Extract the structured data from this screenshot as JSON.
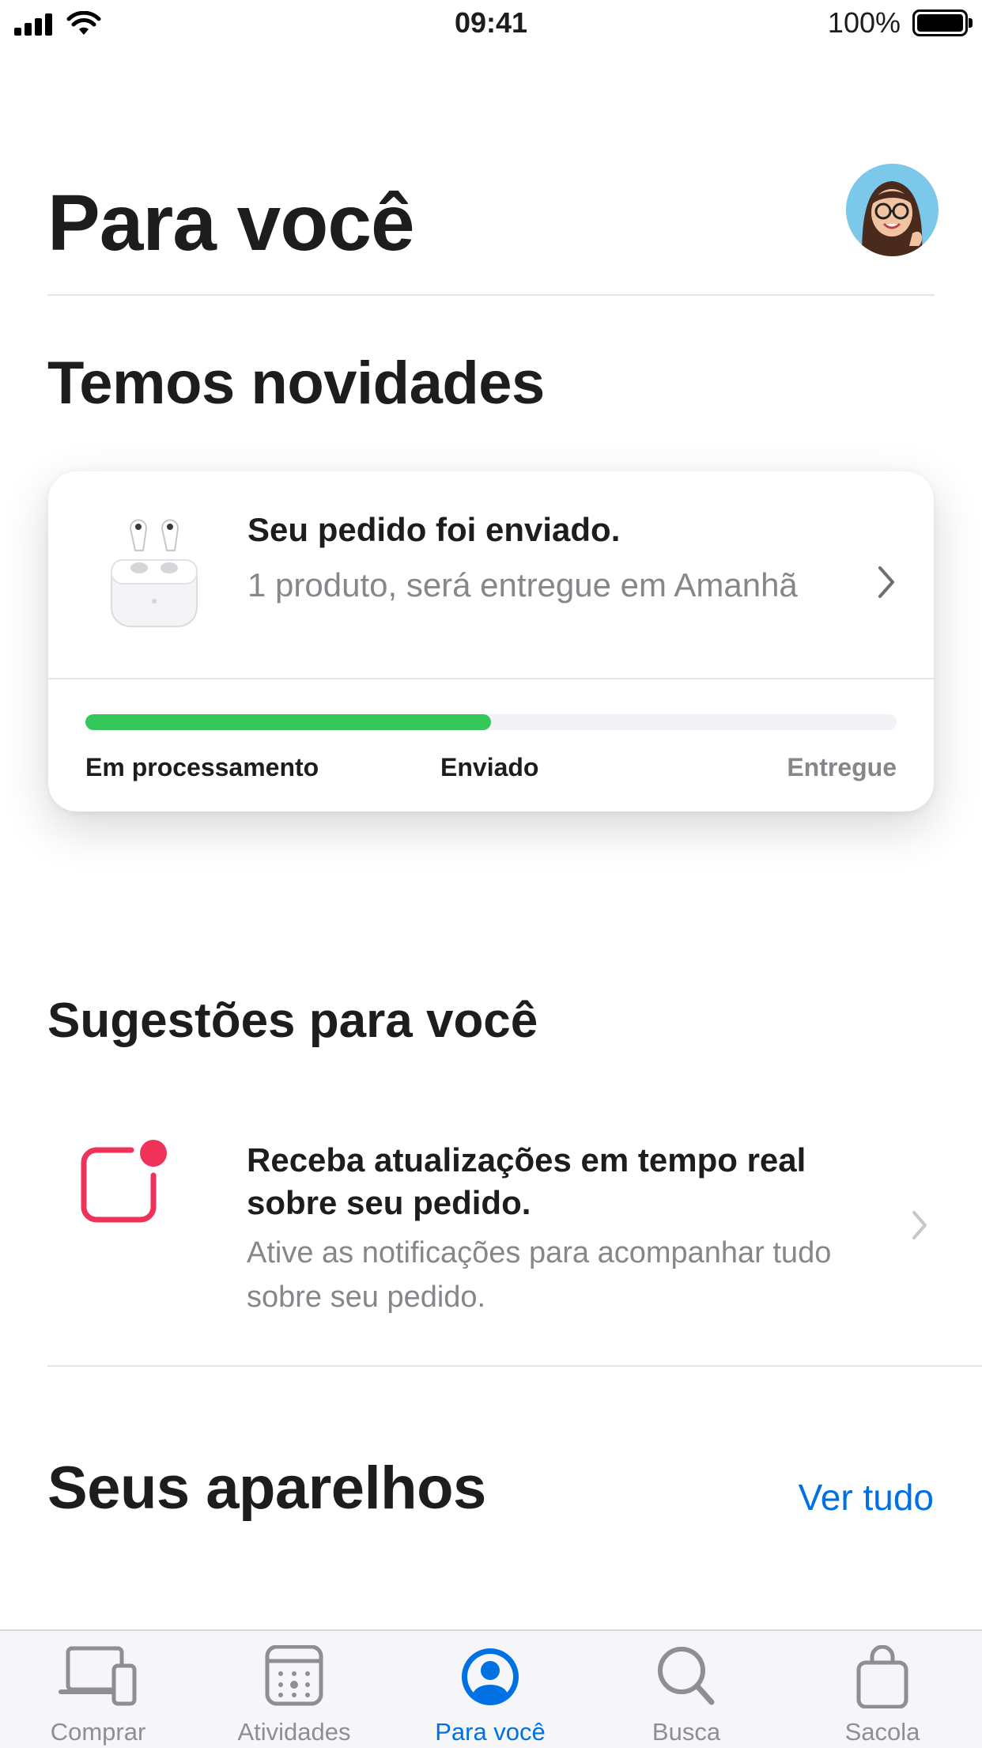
{
  "status_bar": {
    "time": "09:41",
    "battery": "100%"
  },
  "header": {
    "title": "Para você"
  },
  "news": {
    "title": "Temos novidades",
    "order": {
      "title": "Seu pedido foi enviado.",
      "subtitle": "1 produto, será entregue em Amanhã",
      "progress": 0.5,
      "stages": [
        "Em processamento",
        "Enviado",
        "Entregue"
      ]
    }
  },
  "suggestions": {
    "title": "Sugestões para você",
    "item": {
      "title": "Receba atualizações em tempo real sobre seu pedido.",
      "text": "Ative as notificações para acompanhar tudo sobre seu pedido."
    }
  },
  "devices": {
    "title": "Seus aparelhos",
    "link": "Ver tudo"
  },
  "tabbar": {
    "tabs": [
      {
        "label": "Comprar",
        "icon": "devices-icon"
      },
      {
        "label": "Atividades",
        "icon": "calendar-icon"
      },
      {
        "label": "Para você",
        "icon": "person-circle-icon",
        "active": true
      },
      {
        "label": "Busca",
        "icon": "search-icon"
      },
      {
        "label": "Sacola",
        "icon": "bag-icon"
      }
    ]
  },
  "colors": {
    "accent": "#0071e3",
    "progress": "#34c759",
    "notification": "#f0325a"
  }
}
